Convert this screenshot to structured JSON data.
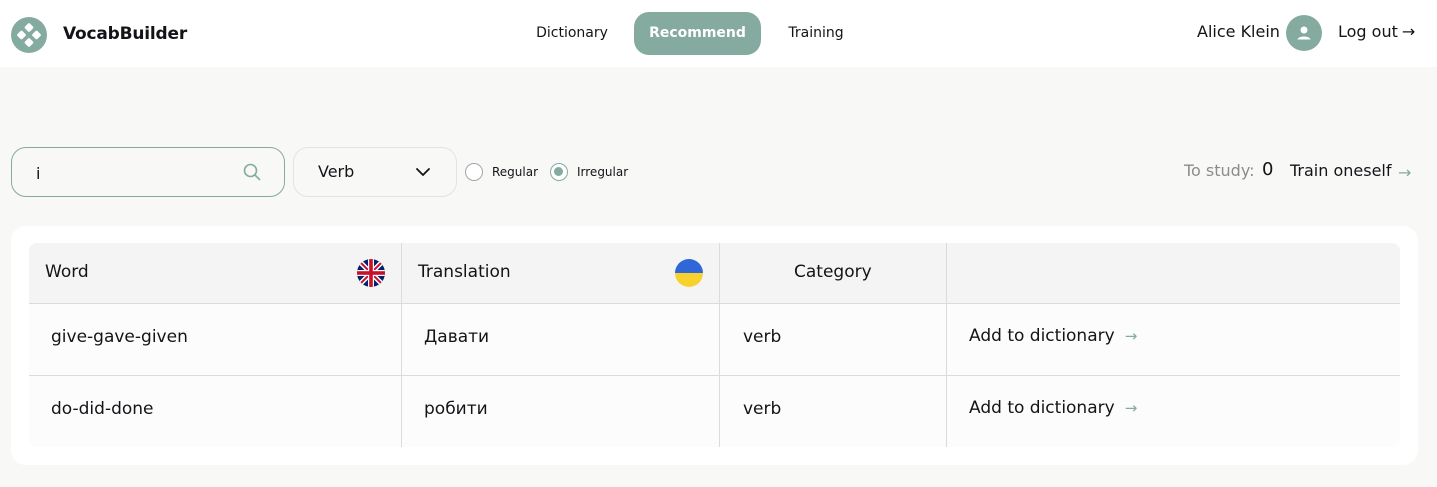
{
  "app": {
    "title": "VocabBuilder"
  },
  "nav": {
    "items": [
      {
        "label": "Dictionary",
        "active": false
      },
      {
        "label": "Recommend",
        "active": true
      },
      {
        "label": "Training",
        "active": false
      }
    ]
  },
  "user": {
    "name": "Alice Klein",
    "logout_label": "Log out",
    "logout_arrow": "→"
  },
  "filters": {
    "search_value": "i",
    "search_icon": "search-icon",
    "category_selected": "Verb",
    "verb_types": [
      {
        "label": "Regular",
        "checked": false
      },
      {
        "label": "Irregular",
        "checked": true
      }
    ]
  },
  "study": {
    "label": "To study:",
    "count": "0",
    "train_label": "Train oneself",
    "train_arrow": "→"
  },
  "table": {
    "headers": {
      "word": "Word",
      "translation": "Translation",
      "category": "Category",
      "action": ""
    },
    "rows": [
      {
        "word": "give-gave-given",
        "translation": "Давати",
        "category": "verb",
        "action": "Add to dictionary",
        "action_arrow": "→"
      },
      {
        "word": "do-did-done",
        "translation": "робити",
        "category": "verb",
        "action": "Add to dictionary",
        "action_arrow": "→"
      }
    ]
  },
  "colors": {
    "accent": "#85aa9f",
    "background": "#f8f8f7",
    "text": "#121417",
    "muted": "#8c8c8c"
  }
}
